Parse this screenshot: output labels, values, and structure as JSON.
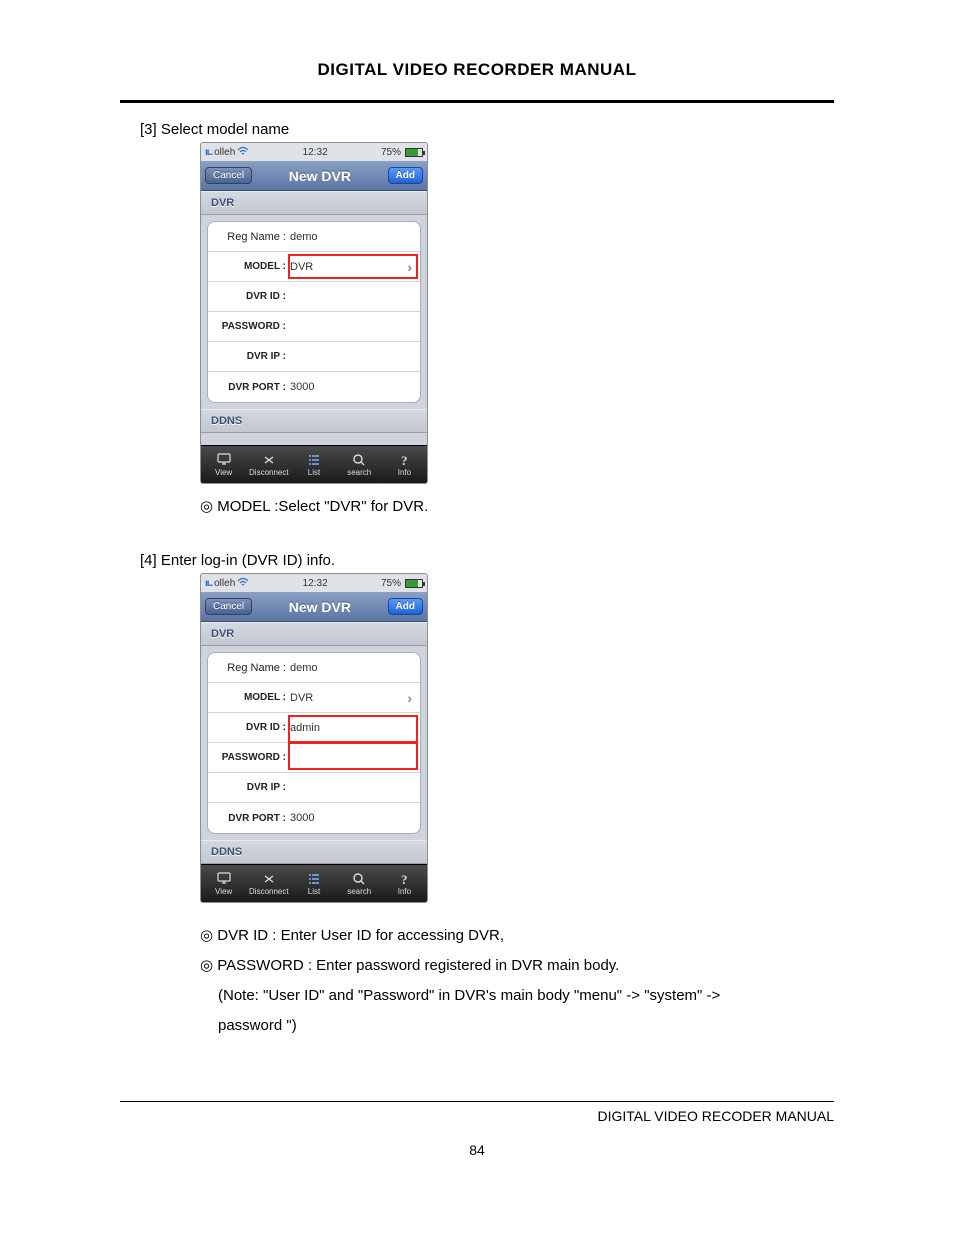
{
  "header": {
    "title": "DIGITAL VIDEO RECORDER MANUAL"
  },
  "step3": {
    "label": "[3] Select model name"
  },
  "step4": {
    "label": "[4] Enter log-in (DVR ID) info."
  },
  "phone": {
    "status": {
      "carrier": "olleh",
      "time": "12:32",
      "battery_pct": "75%"
    },
    "nav": {
      "cancel": "Cancel",
      "title": "New DVR",
      "add": "Add"
    },
    "section_dvr": "DVR",
    "section_ddns": "DDNS",
    "rows": {
      "regname_label": "Reg Name :",
      "regname_value": "demo",
      "model_label": "MODEL :",
      "model_value": "DVR",
      "dvrid_label": "DVR ID :",
      "dvrid_value_s4": "admin",
      "password_label": "PASSWORD :",
      "dvrip_label": "DVR IP :",
      "dvrport_label": "DVR PORT :",
      "dvrport_value": "3000"
    },
    "tabs": {
      "view": "View",
      "disconnect": "Disconnect",
      "list": "List",
      "search": "search",
      "info": "Info"
    }
  },
  "captions": {
    "c3_1": "◎ MODEL :Select \"DVR\" for DVR.",
    "c4_1": "◎ DVR ID : Enter User ID for accessing DVR,",
    "c4_2": "◎ PASSWORD : Enter password registered in DVR main body.",
    "c4_3": "(Note: \"User ID\" and \"Password\" in DVR's main body \"menu\" -> \"system\" ->",
    "c4_4": "password \")"
  },
  "footer": {
    "right": "DIGITAL VIDEO RECODER MANUAL",
    "page": "84"
  }
}
